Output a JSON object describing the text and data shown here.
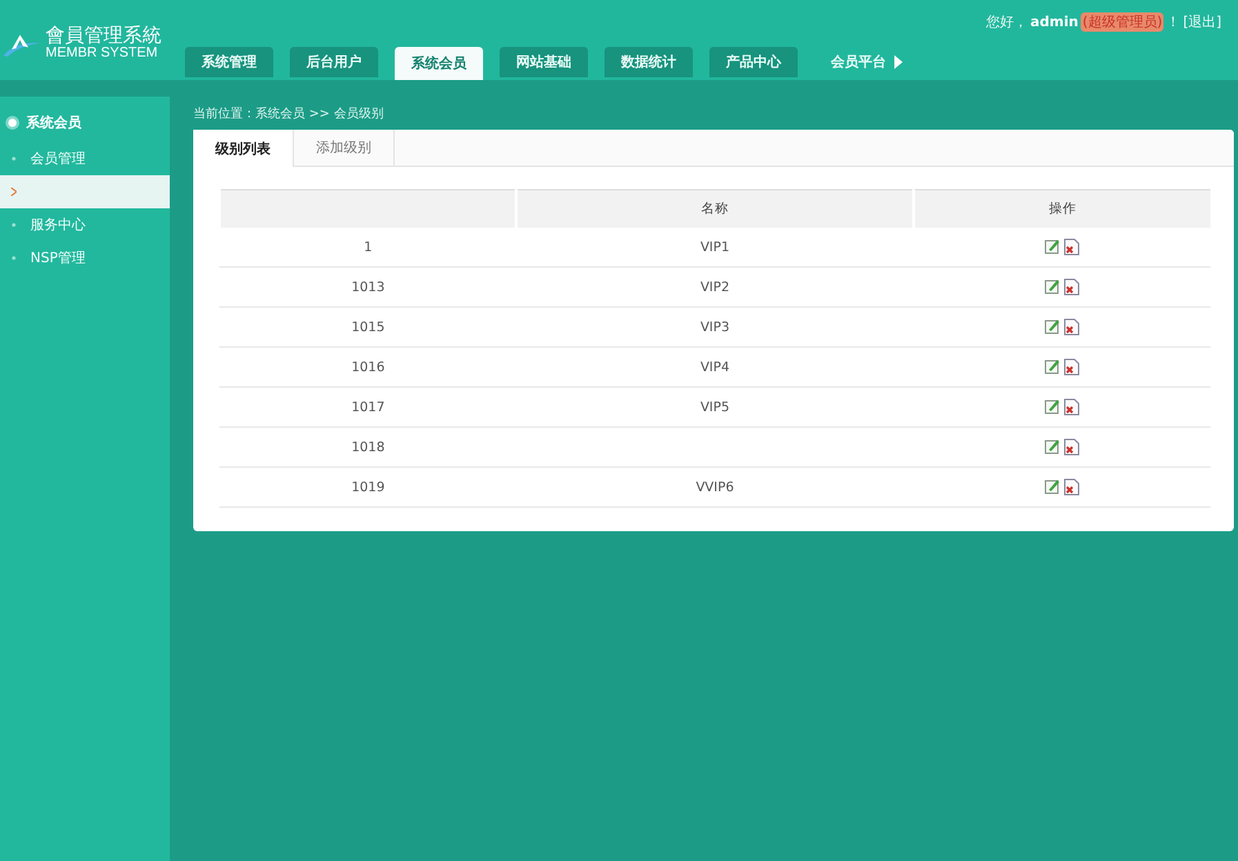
{
  "logo": {
    "title": "會員管理系統",
    "subtitle": "MEMBR SYSTEM"
  },
  "user_bar": {
    "greeting": "您好，",
    "user": "admin",
    "role": "(超级管理员)",
    "separator": "！",
    "logout": "[退出]"
  },
  "nav_tabs": [
    {
      "label": "系统管理",
      "selected": false
    },
    {
      "label": "后台用户",
      "selected": false
    },
    {
      "label": "系统会员",
      "selected": true
    },
    {
      "label": "网站基础",
      "selected": false
    },
    {
      "label": "数据统计",
      "selected": false
    },
    {
      "label": "产品中心",
      "selected": false
    },
    {
      "label": "会员平台",
      "selected": false,
      "kind": "more"
    }
  ],
  "sidebar": {
    "title": "系统会员",
    "items": [
      {
        "label": "会员管理",
        "selected": false
      },
      {
        "selected": true
      },
      {
        "label": "服务中心",
        "selected": false
      },
      {
        "label": "NSP管理",
        "selected": false
      }
    ]
  },
  "breadcrumb": "当前位置：系统会员 >> 会员级别",
  "panel_tabs": [
    {
      "label": "级别列表",
      "selected": true
    },
    {
      "label": "添加级别",
      "selected": false
    }
  ],
  "table": {
    "columns": [
      "",
      "名称",
      "操作"
    ],
    "rows": [
      {
        "id": "1",
        "name": "VIP1"
      },
      {
        "id": "1013",
        "name": "VIP2"
      },
      {
        "id": "1015",
        "name": "VIP3"
      },
      {
        "id": "1016",
        "name": "VIP4"
      },
      {
        "id": "1017",
        "name": "VIP5"
      },
      {
        "id": "1018"
      },
      {
        "id": "1019",
        "name": "VVIP6"
      }
    ]
  }
}
